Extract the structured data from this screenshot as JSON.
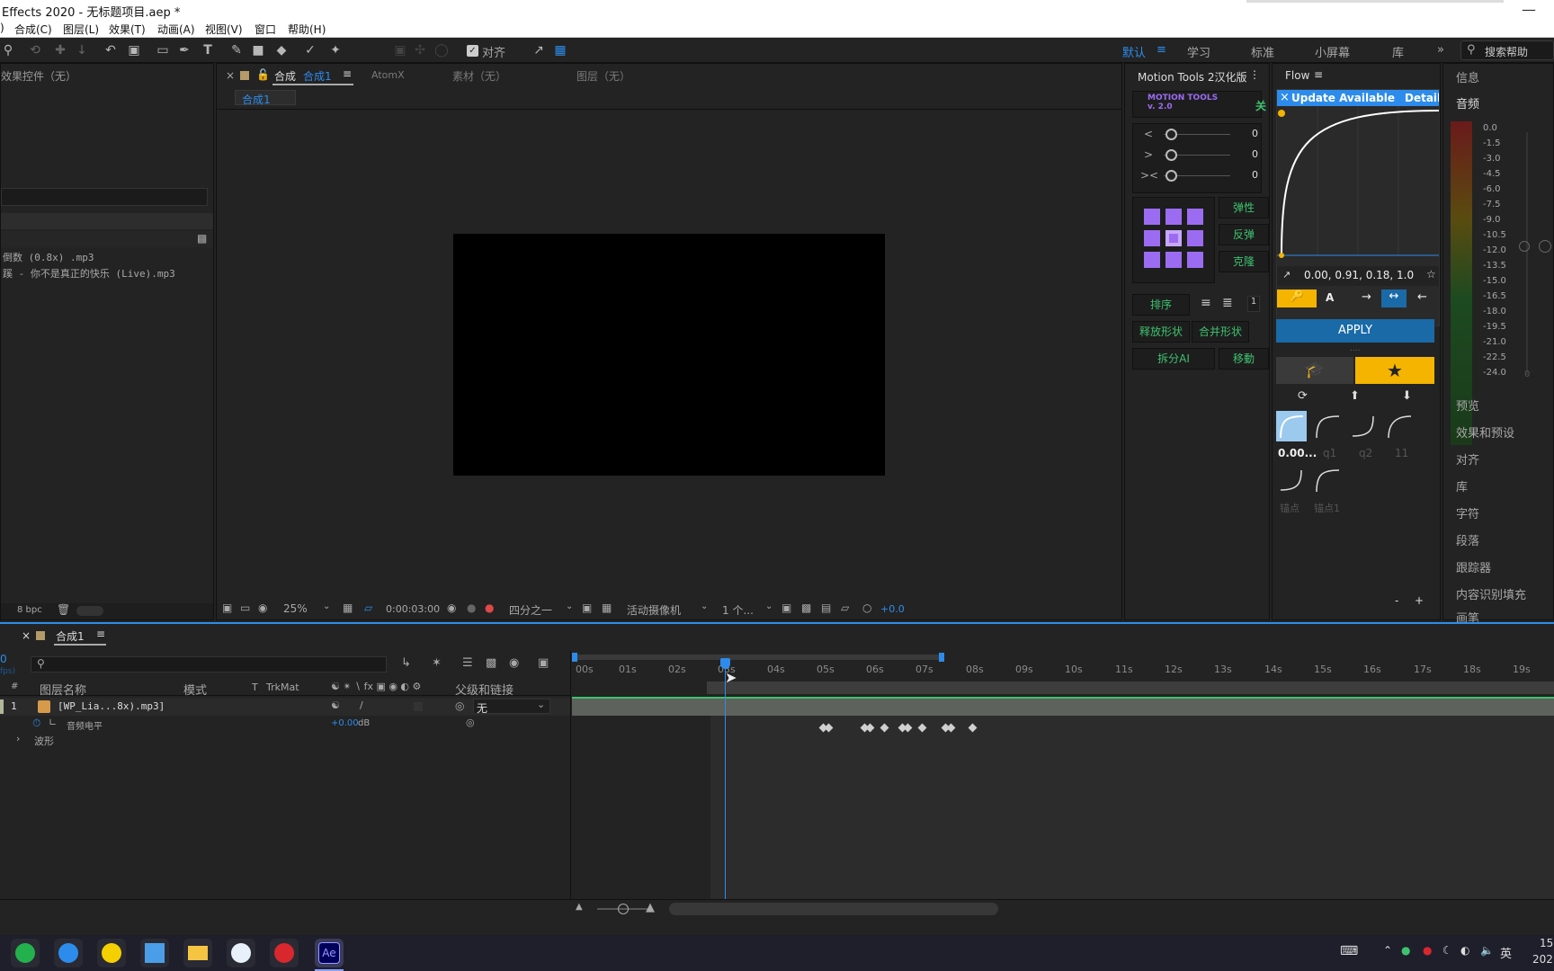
{
  "window": {
    "title": "Effects 2020 - 无标题项目.aep *"
  },
  "menu": [
    "合成(C)",
    "图层(L)",
    "效果(T)",
    "动画(A)",
    "视图(V)",
    "窗口",
    "帮助(H)"
  ],
  "toolbar": {
    "snap_label": "对齐"
  },
  "workspaces": [
    "默认",
    "学习",
    "标准",
    "小屏幕",
    "库"
  ],
  "search": {
    "placeholder": "搜索帮助"
  },
  "effects_panel": {
    "title": "效果控件（无）"
  },
  "project": {
    "files": [
      "倒数 (0.8x) .mp3",
      "蹊 - 你不是真正的快乐 (Live).mp3"
    ],
    "bpc": "8 bpc"
  },
  "comp_panel": {
    "tabs": [
      "合成",
      "合成1",
      "AtomX",
      "素材（无）",
      "图层（无）"
    ],
    "breadcrumb": "合成1",
    "zoom": "25%",
    "timecode": "0:00:03:00",
    "resolution": "四分之一",
    "camera": "活动摄像机",
    "views": "1 个...",
    "exposure": "+0.0"
  },
  "motion_tools": {
    "title": "Motion Tools 2汉化版",
    "logo": "MOTION TOOLS v. 2.0",
    "off_label": "关",
    "sliders": [
      {
        "symbol": "<",
        "value": "0"
      },
      {
        "symbol": ">",
        "value": "0"
      },
      {
        "symbol": "><",
        "value": "0"
      }
    ],
    "buttons": {
      "elastic": "弹性",
      "bounce": "反弹",
      "clone": "克隆",
      "sort": "排序",
      "sort_num": "1",
      "release_shapes": "释放形状",
      "merge_shapes": "合并形状",
      "split_ai": "拆分AI",
      "move": "移動"
    }
  },
  "flow": {
    "title": "Flow",
    "banner": "Update Available",
    "details": "Details",
    "curve_values": "0.00, 0.91, 0.18, 1.0",
    "apply": "APPLY",
    "presets": [
      {
        "label": "0.00..."
      },
      {
        "label": "q1"
      },
      {
        "label": "q2"
      },
      {
        "label": "11"
      },
      {
        "label": "锚点"
      },
      {
        "label": "锚点1"
      }
    ],
    "minus": "-",
    "plus": "+"
  },
  "info_panel": {
    "info": "信息",
    "audio": "音频",
    "db_scale": [
      "0.0",
      "-1.5",
      "-3.0",
      "-4.5",
      "-6.0",
      "-7.5",
      "-9.0",
      "-10.5",
      "-12.0",
      "-13.5",
      "-15.0",
      "-16.5",
      "-18.0",
      "-19.5",
      "-21.0",
      "-22.5",
      "-24.0"
    ],
    "zero": "0",
    "panels": [
      "预览",
      "效果和预设",
      "对齐",
      "库",
      "字符",
      "段落",
      "跟踪器",
      "内容识别填充",
      "画笔"
    ]
  },
  "timeline": {
    "tab": "合成1",
    "cols": {
      "num": "#",
      "name": "图层名称",
      "mode": "模式",
      "t": "T",
      "trkmat": "TrkMat",
      "parent": "父级和链接"
    },
    "layer": {
      "index": "1",
      "name": "[WP_Lia...8x).mp3]",
      "parent": "无"
    },
    "prop": {
      "name": "音频电平",
      "value": "+0.00",
      "unit": "dB"
    },
    "waveform": "波形",
    "ruler": [
      "00s",
      "01s",
      "02s",
      "03s",
      "04s",
      "05s",
      "06s",
      "07s",
      "08s",
      "09s",
      "10s",
      "11s",
      "12s",
      "13s",
      "14s",
      "15s",
      "16s",
      "17s",
      "18s",
      "19s"
    ],
    "time_digit": "0",
    "fps": "fps)"
  },
  "taskbar": {
    "ae": "Ae",
    "ime": "英",
    "clock": "15",
    "year": "202"
  }
}
